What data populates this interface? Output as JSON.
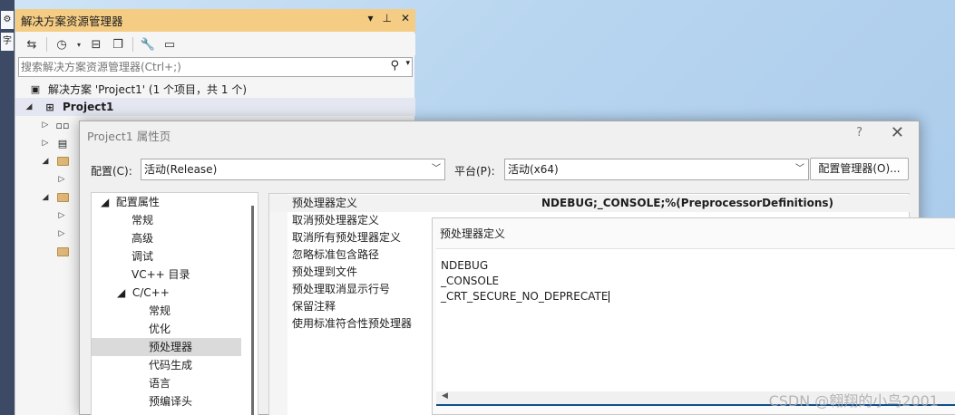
{
  "solution_explorer": {
    "title": "解决方案资源管理器",
    "title_controls": [
      "▾",
      "⊥",
      "✕"
    ],
    "search_placeholder": "搜索解决方案资源管理器(Ctrl+;)",
    "solution_label": "解决方案 'Project1' (1 个项目，共 1 个)",
    "project_label": "Project1"
  },
  "dialog": {
    "title": "Project1 属性页",
    "help": "?",
    "close": "✕",
    "config_label": "配置(C):",
    "config_value": "活动(Release)",
    "platform_label": "平台(P):",
    "platform_value": "活动(x64)",
    "config_manager_button": "配置管理器(O)...",
    "tree": {
      "root": "配置属性",
      "items": [
        "常规",
        "高级",
        "调试",
        "VC++ 目录"
      ],
      "cpp": "C/C++",
      "cpp_items": [
        "常规",
        "优化",
        "预处理器",
        "代码生成",
        "语言",
        "预编译头"
      ]
    },
    "grid": {
      "rows": [
        {
          "name": "预处理器定义",
          "value": "NDEBUG;_CONSOLE;%(PreprocessorDefinitions)"
        },
        {
          "name": "取消预处理器定义",
          "value": ""
        },
        {
          "name": "取消所有预处理器定义",
          "value": ""
        },
        {
          "name": "忽略标准包含路径",
          "value": ""
        },
        {
          "name": "预处理到文件",
          "value": ""
        },
        {
          "name": "预处理取消显示行号",
          "value": ""
        },
        {
          "name": "保留注释",
          "value": ""
        },
        {
          "name": "使用标准符合性预处理器",
          "value": ""
        }
      ]
    }
  },
  "edit_dialog": {
    "title": "预处理器定义",
    "lines": [
      "NDEBUG",
      "_CONSOLE",
      "_CRT_SECURE_NO_DEPRECATE"
    ]
  },
  "watermark": "CSDN @翱翔的小鸟2001"
}
